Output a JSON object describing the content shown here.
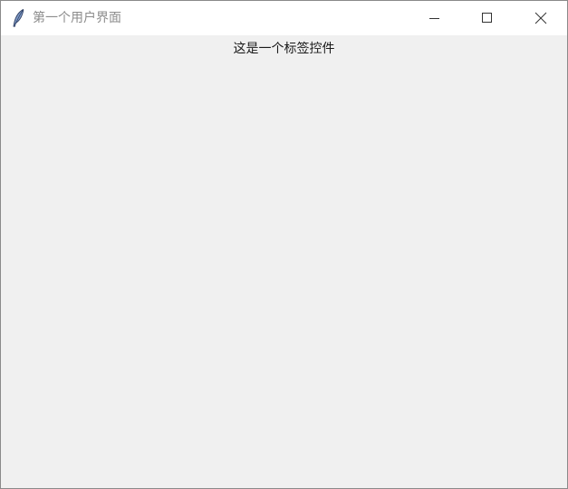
{
  "window": {
    "title": "第一个用户界面",
    "icons": {
      "app": "tk-feather-icon",
      "minimize": "minimize-icon",
      "maximize": "maximize-icon",
      "close": "close-icon"
    }
  },
  "content": {
    "label_text": "这是一个标签控件"
  },
  "colors": {
    "titlebar_bg": "#ffffff",
    "client_bg": "#f0f0f0",
    "title_text": "#8c8c8c",
    "label_text": "#1a1a1a"
  }
}
